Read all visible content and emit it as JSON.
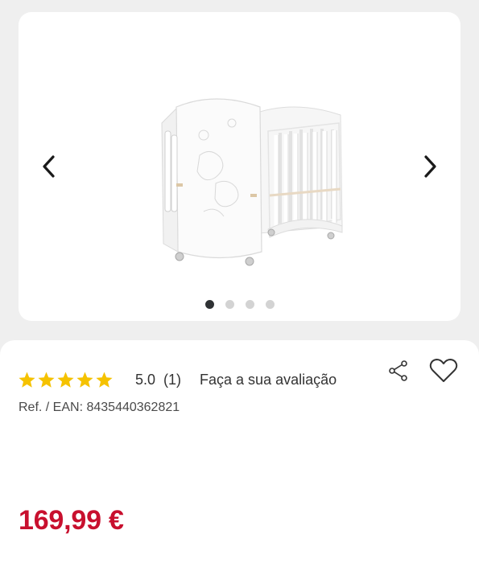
{
  "gallery": {
    "prev_icon": "chevron-left-icon",
    "next_icon": "chevron-right-icon",
    "image_alt": "baby-crib-photo",
    "dots": [
      {
        "active": true
      },
      {
        "active": false
      },
      {
        "active": false
      },
      {
        "active": false
      }
    ],
    "active_dot_color": "#2f3234",
    "inactive_dot_color": "#d3d3d3"
  },
  "product": {
    "rating": {
      "stars": 5,
      "score": "5.0",
      "count": "(1)",
      "review_link": "Faça a sua avaliação",
      "star_color": "#f5c200"
    },
    "ref": "Ref. / EAN: 8435440362821",
    "price": "169,99 €",
    "price_color": "#c8102e",
    "share_icon": "share-icon",
    "favorite_icon": "heart-icon"
  }
}
